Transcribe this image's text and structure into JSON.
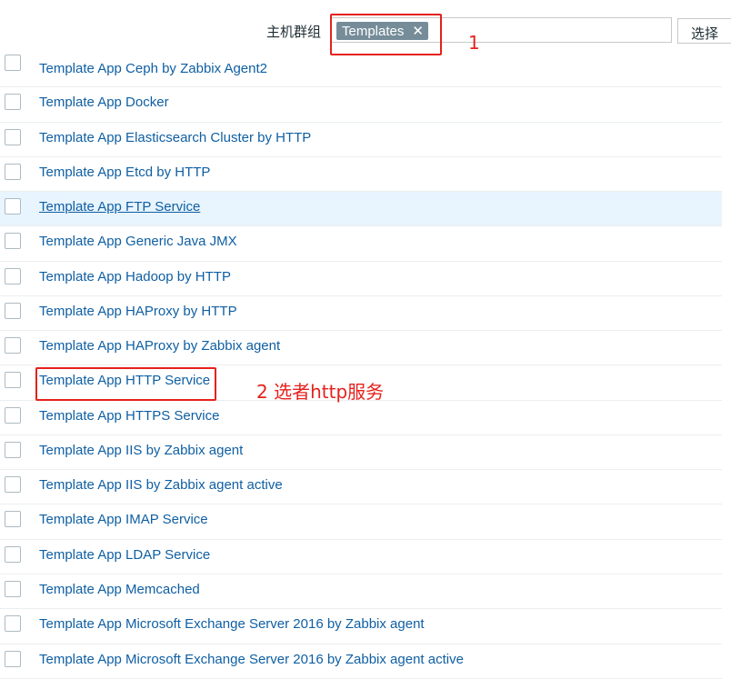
{
  "filter": {
    "label": "主机群组",
    "selected_tag": "Templates",
    "remove_symbol": "✕",
    "select_button": "选择"
  },
  "templates": [
    "Template App Ceph by Zabbix Agent2",
    "Template App Docker",
    "Template App Elasticsearch Cluster by HTTP",
    "Template App Etcd by HTTP",
    "Template App FTP Service",
    "Template App Generic Java JMX",
    "Template App Hadoop by HTTP",
    "Template App HAProxy by HTTP",
    "Template App HAProxy by Zabbix agent",
    "Template App HTTP Service",
    "Template App HTTPS Service",
    "Template App IIS by Zabbix agent",
    "Template App IIS by Zabbix agent active",
    "Template App IMAP Service",
    "Template App LDAP Service",
    "Template App Memcached",
    "Template App Microsoft Exchange Server 2016 by Zabbix agent",
    "Template App Microsoft Exchange Server 2016 by Zabbix agent active"
  ],
  "hovered_index": 4,
  "annotations": {
    "step1": "1",
    "step2": "2 选者http服务"
  },
  "colors": {
    "link": "#0f5fa3",
    "tag_bg": "#768d99",
    "hover_row": "#e8f4fe",
    "annotation": "#e5211c"
  }
}
